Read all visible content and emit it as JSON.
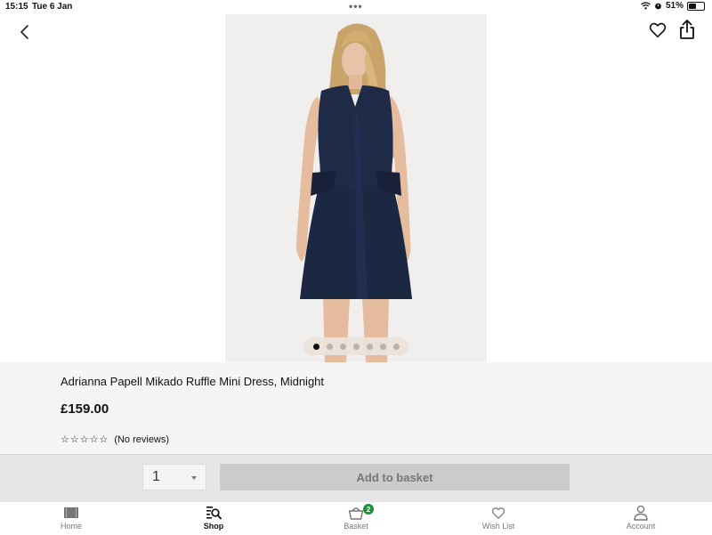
{
  "status_bar": {
    "time": "15:15",
    "date": "Tue 6 Jan",
    "dots": "•••",
    "battery_percent": "51%",
    "battery_level": 0.51
  },
  "gallery": {
    "image_count": 7,
    "active_index": 0,
    "photo_alt": "Navy sleeveless mini dress with peplum pockets on model"
  },
  "product": {
    "name": "Adrianna Papell Mikado Ruffle Mini Dress, Midnight",
    "price": "£159.00",
    "stars_empty": "☆☆☆☆☆",
    "rating_value": 0,
    "reviews_label": "(No reviews)"
  },
  "basket_bar": {
    "quantity": "1",
    "add_label": "Add to basket"
  },
  "tabs": [
    {
      "label": "Home",
      "icon": "home-icon",
      "active": false
    },
    {
      "label": "Shop",
      "icon": "shop-search-icon",
      "active": true
    },
    {
      "label": "Basket",
      "icon": "basket-icon",
      "badge": "2",
      "active": false
    },
    {
      "label": "Wish List",
      "icon": "heart-icon",
      "active": false
    },
    {
      "label": "Account",
      "icon": "account-icon",
      "active": false
    }
  ],
  "colors": {
    "accent_badge": "#1e8f3a",
    "dress": "#1c2742",
    "disabled_button": "#cbcbcb"
  }
}
